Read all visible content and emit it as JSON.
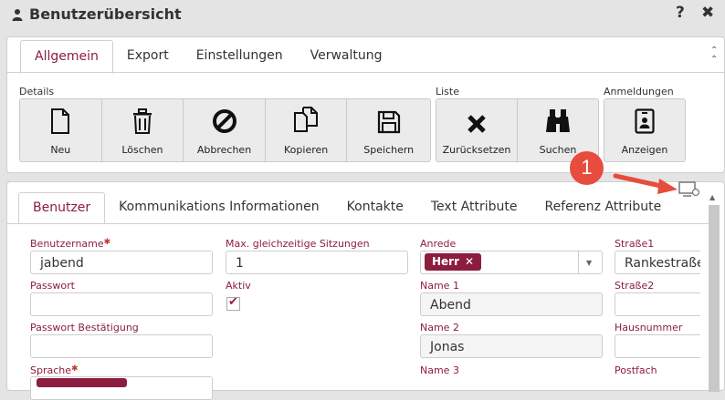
{
  "window": {
    "title": "Benutzerübersicht",
    "help": "?",
    "close": "✖"
  },
  "top_tabs": [
    {
      "label": "Allgemein",
      "active": true
    },
    {
      "label": "Export",
      "active": false
    },
    {
      "label": "Einstellungen",
      "active": false
    },
    {
      "label": "Verwaltung",
      "active": false
    }
  ],
  "toolbar": {
    "groups": {
      "details": "Details",
      "liste": "Liste",
      "anmeldungen": "Anmeldungen"
    },
    "buttons": {
      "neu": "Neu",
      "loeschen": "Löschen",
      "abbrechen": "Abbrechen",
      "kopieren": "Kopieren",
      "speichern": "Speichern",
      "zuruecksetzen": "Zurücksetzen",
      "suchen": "Suchen",
      "anzeigen": "Anzeigen"
    }
  },
  "annotation": {
    "number": "1",
    "color": "#e74c3c"
  },
  "bottom_tabs": [
    {
      "label": "Benutzer",
      "active": true
    },
    {
      "label": "Kommunikations Informationen",
      "active": false
    },
    {
      "label": "Kontakte",
      "active": false
    },
    {
      "label": "Text Attribute",
      "active": false
    },
    {
      "label": "Referenz Attribute",
      "active": false
    }
  ],
  "form": {
    "benutzername": {
      "label": "Benutzername",
      "value": "jabend",
      "required": "✱"
    },
    "passwort": {
      "label": "Passwort",
      "value": ""
    },
    "passwort_bestaetigung": {
      "label": "Passwort Bestätigung",
      "value": ""
    },
    "sprache": {
      "label": "Sprache",
      "required": "✱"
    },
    "max_sitzungen": {
      "label": "Max. gleichzeitige Sitzungen",
      "value": "1"
    },
    "aktiv": {
      "label": "Aktiv",
      "checked": true,
      "check": "✔"
    },
    "anrede": {
      "label": "Anrede",
      "value": "Herr",
      "remove": "✕"
    },
    "name1": {
      "label": "Name 1",
      "value": "Abend"
    },
    "name2": {
      "label": "Name 2",
      "value": "Jonas"
    },
    "name3": {
      "label": "Name 3"
    },
    "strasse1": {
      "label": "Straße1",
      "value": "Rankestraße"
    },
    "strasse2": {
      "label": "Straße2",
      "value": ""
    },
    "hausnummer": {
      "label": "Hausnummer",
      "value": ""
    },
    "postfach": {
      "label": "Postfach"
    }
  },
  "colors": {
    "accent": "#8c1d3e",
    "required": "#c0392b",
    "annotation": "#e74c3c"
  }
}
